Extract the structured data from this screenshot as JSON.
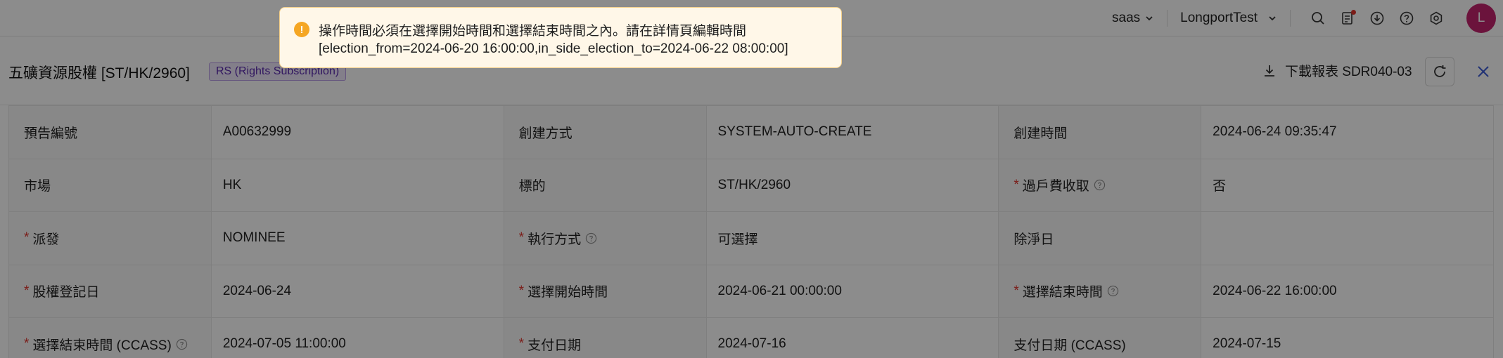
{
  "topbar": {
    "tenant": "saas",
    "account": "LongportTest",
    "icons": [
      "search-icon",
      "task-list-icon",
      "download-cloud-icon",
      "help-icon",
      "settings-icon"
    ],
    "avatar": "L"
  },
  "header": {
    "title": "五礦資源股權 [ST/HK/2960]",
    "tag": "RS (Rights Subscription)",
    "download_label": "下載報表 SDR040-03"
  },
  "table": {
    "rows": [
      [
        {
          "label": "預告編號",
          "required": false,
          "help": false,
          "value": "A00632999"
        },
        {
          "label": "創建方式",
          "required": false,
          "help": false,
          "value": "SYSTEM-AUTO-CREATE"
        },
        {
          "label": "創建時間",
          "required": false,
          "help": false,
          "value": "2024-06-24 09:35:47"
        }
      ],
      [
        {
          "label": "市場",
          "required": false,
          "help": false,
          "value": "HK"
        },
        {
          "label": "標的",
          "required": false,
          "help": false,
          "value": "ST/HK/2960"
        },
        {
          "label": "過戶費收取",
          "required": true,
          "help": true,
          "value": "否"
        }
      ],
      [
        {
          "label": "派發",
          "required": true,
          "help": false,
          "value": "NOMINEE"
        },
        {
          "label": "執行方式",
          "required": true,
          "help": true,
          "value": "可選擇"
        },
        {
          "label": "除淨日",
          "required": false,
          "help": false,
          "value": ""
        }
      ],
      [
        {
          "label": "股權登記日",
          "required": true,
          "help": false,
          "value": "2024-06-24"
        },
        {
          "label": "選擇開始時間",
          "required": true,
          "help": false,
          "value": "2024-06-21 00:00:00"
        },
        {
          "label": "選擇結束時間",
          "required": true,
          "help": true,
          "value": "2024-06-22 16:00:00"
        }
      ],
      [
        {
          "label": "選擇結束時間 (CCASS)",
          "required": true,
          "help": true,
          "value": "2024-07-05 11:00:00"
        },
        {
          "label": "支付日期",
          "required": true,
          "help": false,
          "value": "2024-07-16"
        },
        {
          "label": "支付日期 (CCASS)",
          "required": false,
          "help": false,
          "value": "2024-07-15"
        }
      ]
    ]
  },
  "toast": {
    "type": "warning",
    "line1": "操作時間必須在選擇開始時間和選擇結束時間之內。請在詳情頁編輯時間",
    "line2": "[election_from=2024-06-20 16:00:00,in_side_election_to=2024-06-22 08:00:00]"
  },
  "colors": {
    "required": "#e0342c",
    "tag_text": "#5b2bb0",
    "avatar": "#c4246d",
    "warning": "#f5a623"
  }
}
